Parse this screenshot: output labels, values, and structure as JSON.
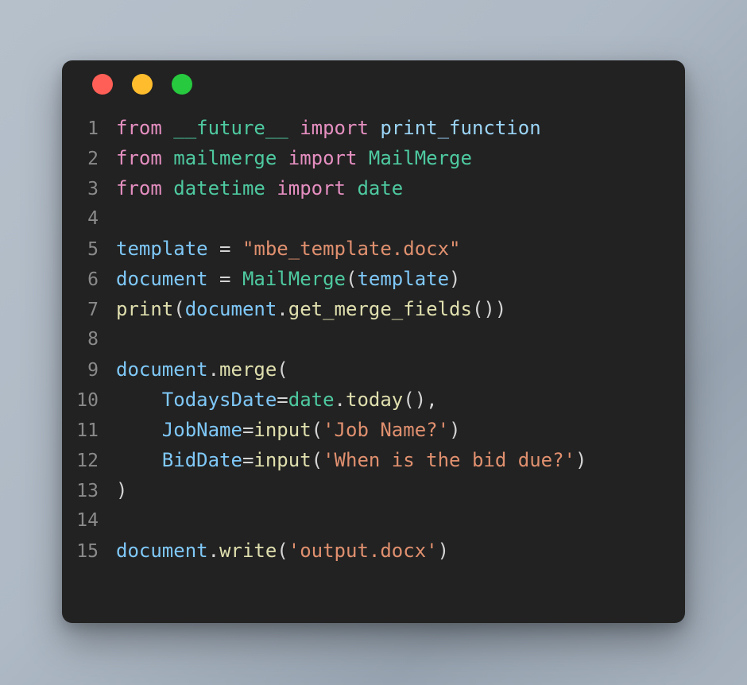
{
  "window": {
    "background_color": "#222222",
    "traffic_lights": [
      {
        "name": "close",
        "color": "#ff5f56"
      },
      {
        "name": "minimize",
        "color": "#ffbd2e"
      },
      {
        "name": "maximize",
        "color": "#27c93f"
      }
    ]
  },
  "editor": {
    "language": "python",
    "gutter_color": "#8a8a8a",
    "lines": [
      {
        "number": "1",
        "text": "from __future__ import print_function",
        "tokens": [
          {
            "t": "from",
            "c": "kw"
          },
          {
            "t": " ",
            "c": "pun"
          },
          {
            "t": "__future__",
            "c": "mod"
          },
          {
            "t": " ",
            "c": "pun"
          },
          {
            "t": "import",
            "c": "kw"
          },
          {
            "t": " ",
            "c": "pun"
          },
          {
            "t": "print_function",
            "c": "blu"
          }
        ]
      },
      {
        "number": "2",
        "text": "from mailmerge import MailMerge",
        "tokens": [
          {
            "t": "from",
            "c": "kw"
          },
          {
            "t": " ",
            "c": "pun"
          },
          {
            "t": "mailmerge",
            "c": "mod"
          },
          {
            "t": " ",
            "c": "pun"
          },
          {
            "t": "import",
            "c": "kw"
          },
          {
            "t": " ",
            "c": "pun"
          },
          {
            "t": "MailMerge",
            "c": "cls"
          }
        ]
      },
      {
        "number": "3",
        "text": "from datetime import date",
        "tokens": [
          {
            "t": "from",
            "c": "kw"
          },
          {
            "t": " ",
            "c": "pun"
          },
          {
            "t": "datetime",
            "c": "mod"
          },
          {
            "t": " ",
            "c": "pun"
          },
          {
            "t": "import",
            "c": "kw"
          },
          {
            "t": " ",
            "c": "pun"
          },
          {
            "t": "date",
            "c": "cls"
          }
        ]
      },
      {
        "number": "4",
        "text": "",
        "tokens": []
      },
      {
        "number": "5",
        "text": "template = \"mbe_template.docx\"",
        "tokens": [
          {
            "t": "template",
            "c": "var"
          },
          {
            "t": " ",
            "c": "pun"
          },
          {
            "t": "=",
            "c": "op"
          },
          {
            "t": " ",
            "c": "pun"
          },
          {
            "t": "\"mbe_template.docx\"",
            "c": "str"
          }
        ]
      },
      {
        "number": "6",
        "text": "document = MailMerge(template)",
        "tokens": [
          {
            "t": "document",
            "c": "var"
          },
          {
            "t": " ",
            "c": "pun"
          },
          {
            "t": "=",
            "c": "op"
          },
          {
            "t": " ",
            "c": "pun"
          },
          {
            "t": "MailMerge",
            "c": "cls"
          },
          {
            "t": "(",
            "c": "pun"
          },
          {
            "t": "template",
            "c": "var"
          },
          {
            "t": ")",
            "c": "pun"
          }
        ]
      },
      {
        "number": "7",
        "text": "print(document.get_merge_fields())",
        "tokens": [
          {
            "t": "print",
            "c": "fn"
          },
          {
            "t": "(",
            "c": "pun"
          },
          {
            "t": "document",
            "c": "var"
          },
          {
            "t": ".",
            "c": "pun"
          },
          {
            "t": "get_merge_fields",
            "c": "fn"
          },
          {
            "t": "())",
            "c": "pun"
          }
        ]
      },
      {
        "number": "8",
        "text": "",
        "tokens": []
      },
      {
        "number": "9",
        "text": "document.merge(",
        "tokens": [
          {
            "t": "document",
            "c": "var"
          },
          {
            "t": ".",
            "c": "pun"
          },
          {
            "t": "merge",
            "c": "fn"
          },
          {
            "t": "(",
            "c": "pun"
          }
        ]
      },
      {
        "number": "10",
        "text": "    TodaysDate=date.today(),",
        "tokens": [
          {
            "t": "    ",
            "c": "pun"
          },
          {
            "t": "TodaysDate",
            "c": "var"
          },
          {
            "t": "=",
            "c": "op"
          },
          {
            "t": "date",
            "c": "cls"
          },
          {
            "t": ".",
            "c": "pun"
          },
          {
            "t": "today",
            "c": "fn"
          },
          {
            "t": "(),",
            "c": "pun"
          }
        ]
      },
      {
        "number": "11",
        "text": "    JobName=input('Job Name?')",
        "tokens": [
          {
            "t": "    ",
            "c": "pun"
          },
          {
            "t": "JobName",
            "c": "var"
          },
          {
            "t": "=",
            "c": "op"
          },
          {
            "t": "input",
            "c": "fn"
          },
          {
            "t": "(",
            "c": "pun"
          },
          {
            "t": "'Job Name?'",
            "c": "str"
          },
          {
            "t": ")",
            "c": "pun"
          }
        ]
      },
      {
        "number": "12",
        "text": "    BidDate=input('When is the bid due?')",
        "tokens": [
          {
            "t": "    ",
            "c": "pun"
          },
          {
            "t": "BidDate",
            "c": "var"
          },
          {
            "t": "=",
            "c": "op"
          },
          {
            "t": "input",
            "c": "fn"
          },
          {
            "t": "(",
            "c": "pun"
          },
          {
            "t": "'When is the bid due?'",
            "c": "str"
          },
          {
            "t": ")",
            "c": "pun"
          }
        ]
      },
      {
        "number": "13",
        "text": ")",
        "tokens": [
          {
            "t": ")",
            "c": "pun"
          }
        ]
      },
      {
        "number": "14",
        "text": "",
        "tokens": []
      },
      {
        "number": "15",
        "text": "document.write('output.docx')",
        "tokens": [
          {
            "t": "document",
            "c": "var"
          },
          {
            "t": ".",
            "c": "pun"
          },
          {
            "t": "write",
            "c": "fn"
          },
          {
            "t": "(",
            "c": "pun"
          },
          {
            "t": "'output.docx'",
            "c": "str"
          },
          {
            "t": ")",
            "c": "pun"
          }
        ]
      }
    ]
  }
}
